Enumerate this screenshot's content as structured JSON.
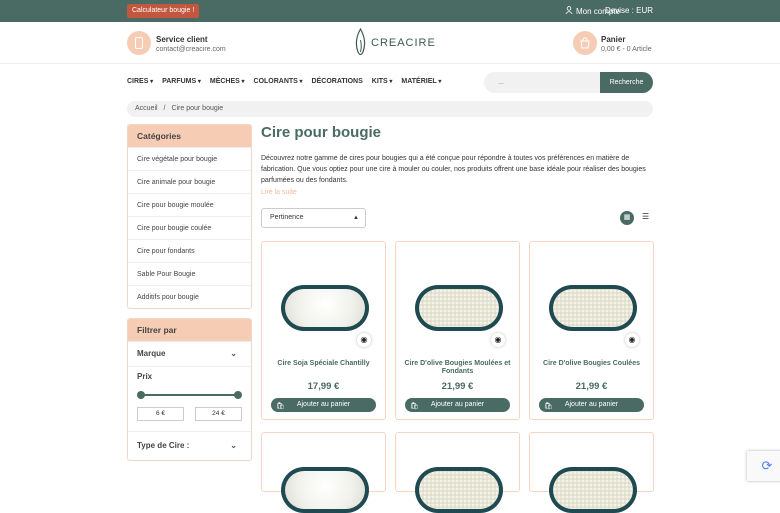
{
  "topbar": {
    "calc_label": "Calculateur bougie !",
    "account_label": "Mon compte",
    "devise_label": "Devise : EUR"
  },
  "header": {
    "service_title": "Service client",
    "service_email": "contact@creacire.com",
    "logo_text": "CREACIRE",
    "cart_title": "Panier",
    "cart_summary": "0,00 € - 0 Article"
  },
  "nav": [
    "CIRES",
    "PARFUMS",
    "MÈCHES",
    "COLORANTS",
    "DÉCORATIONS",
    "KITS",
    "MATÉRIEL"
  ],
  "nav_has_dropdown": [
    true,
    true,
    true,
    true,
    false,
    true,
    true
  ],
  "search": {
    "placeholder": "...",
    "button": "Recherche"
  },
  "breadcrumb": {
    "home": "Accueil",
    "separator": "/",
    "current": "Cire pour bougie"
  },
  "sidebar": {
    "categories_title": "Catégories",
    "categories": [
      "Cire végétale pour bougie",
      "Cire animale pour bougie",
      "Cire pour bougie moulée",
      "Cire pour bougie coulée",
      "Cire pour fondants",
      "Sable Pour Bougie",
      "Additifs pour bougie"
    ],
    "filter_title": "Filtrer par",
    "brand_label": "Marque",
    "price_label": "Prix",
    "price_min": "6 €",
    "price_max": "24 €",
    "type_label": "Type de Cire :"
  },
  "main": {
    "title": "Cire pour bougie",
    "description": "Découvrez notre gamme de cires pour bougies qui a été conçue pour répondre à toutes vos préférences en matière de fabrication. Que vous optiez pour une cire à mouler ou couler, nos produits offrent une base idéale pour réaliser des bougies parfumées ou des fondants.",
    "read_more": "Lire la suite",
    "sort_label": "Pertinence"
  },
  "products": [
    {
      "name": "Cire Soja Spéciale Chantilly",
      "price": "17,99 €",
      "button": "Ajouter au panier"
    },
    {
      "name": "Cire D'olive Bougies Moulées et Fondants",
      "price": "21,99 €",
      "button": "Ajouter au panier"
    },
    {
      "name": "Cire D'olive Bougies Coulées",
      "price": "21,99 €",
      "button": "Ajouter au panier"
    }
  ],
  "colors": {
    "primary": "#4a6b63",
    "accent": "#f6cdb4",
    "calc": "#c2573f"
  }
}
